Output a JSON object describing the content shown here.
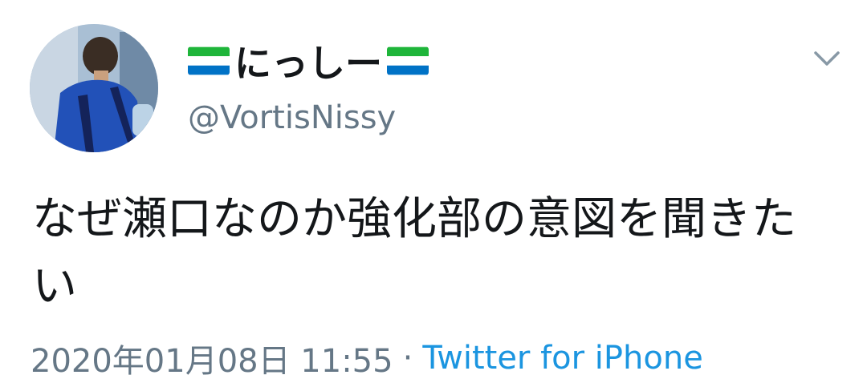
{
  "author": {
    "display_name": "にっしー",
    "handle": "@VortisNissy",
    "avatar_icon": "profile-photo",
    "name_flag_icon": "flag-sierra-leone"
  },
  "menu": {
    "icon": "chevron-down-icon"
  },
  "tweet": {
    "text": "なぜ瀬口なのか強化部の意図を聞きたい",
    "timestamp": "2020年01月08日 11:55",
    "separator": "·",
    "source": "Twitter for iPhone"
  },
  "colors": {
    "text": "#14171a",
    "secondary": "#657786",
    "link": "#1b95e0"
  }
}
